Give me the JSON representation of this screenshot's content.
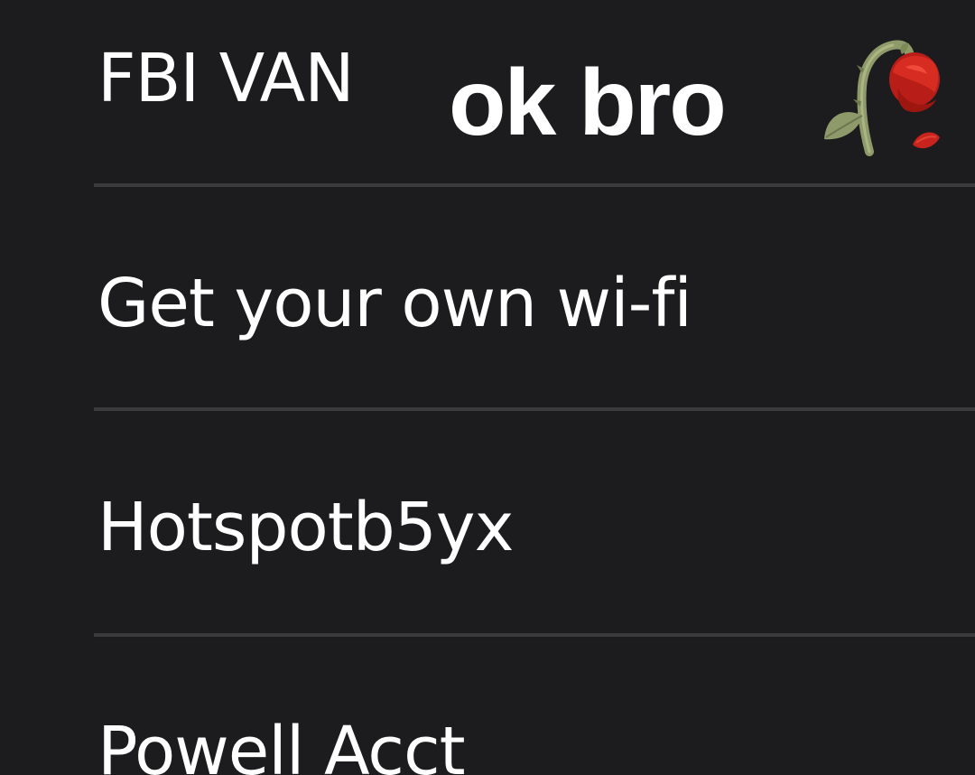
{
  "networks": [
    {
      "name": "FBI VAN"
    },
    {
      "name": "Get your own wi-fi"
    },
    {
      "name": "Hotspotb5yx"
    },
    {
      "name": "Powell Acct"
    }
  ],
  "overlay": {
    "caption": "ok bro",
    "emoji_icon": "wilted-rose-icon"
  },
  "colors": {
    "background": "#1c1c1e",
    "text": "#ffffff",
    "separator": "#3a3a3d",
    "rose_red": "#c8231c",
    "stem_green": "#8e9a6a"
  }
}
